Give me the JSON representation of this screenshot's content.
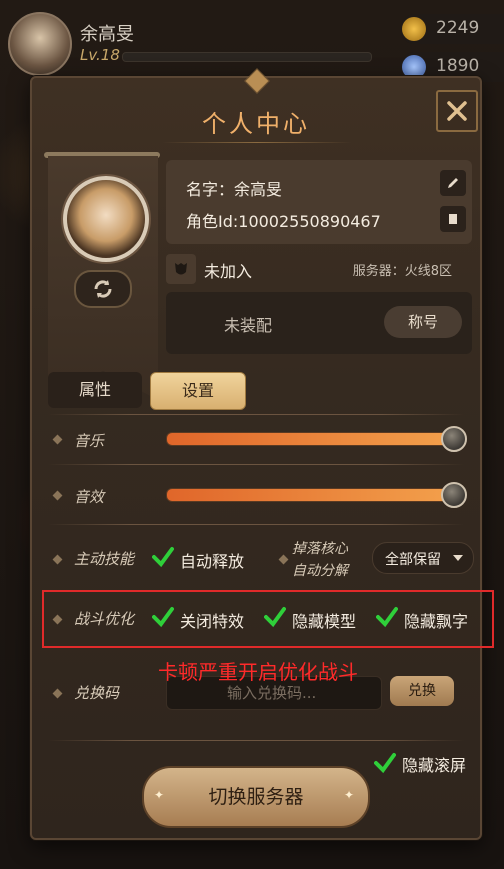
{
  "hud": {
    "player_name": "余高旻",
    "level": "Lv.18",
    "coins": "2249",
    "gems": "1890"
  },
  "panel": {
    "title": "个人中心",
    "name_line": "名字：余高旻",
    "role_id_line": "角色Id:10002550890467",
    "guild_status": "未加入",
    "server": "服务器：火线8区",
    "title_status": "未装配",
    "title_button": "称号"
  },
  "tabs": {
    "attributes": "属性",
    "settings": "设置"
  },
  "settings": {
    "music_label": "音乐",
    "music_level": 0.96,
    "sfx_label": "音效",
    "sfx_level": 0.96,
    "skill_label": "主动技能",
    "auto_cast": "自动释放",
    "drop_label_1": "掉落核心",
    "drop_label_2": "自动分解",
    "drop_option": "全部保留",
    "battle_label": "战斗优化",
    "close_effects": "关闭特效",
    "hide_models": "隐藏模型",
    "hide_floating_text": "隐藏飘字",
    "annotation": "卡顿严重开启优化战斗",
    "redeem_label": "兑换码",
    "redeem_placeholder": "输入兑换码...",
    "redeem_button": "兑换",
    "hide_scroll": "隐藏滚屏",
    "switch_server": "切换服务器"
  },
  "colors": {
    "accent": "#f0b06a",
    "check_green": "#2fcf3a",
    "annotation_red": "#ff2a2a"
  }
}
